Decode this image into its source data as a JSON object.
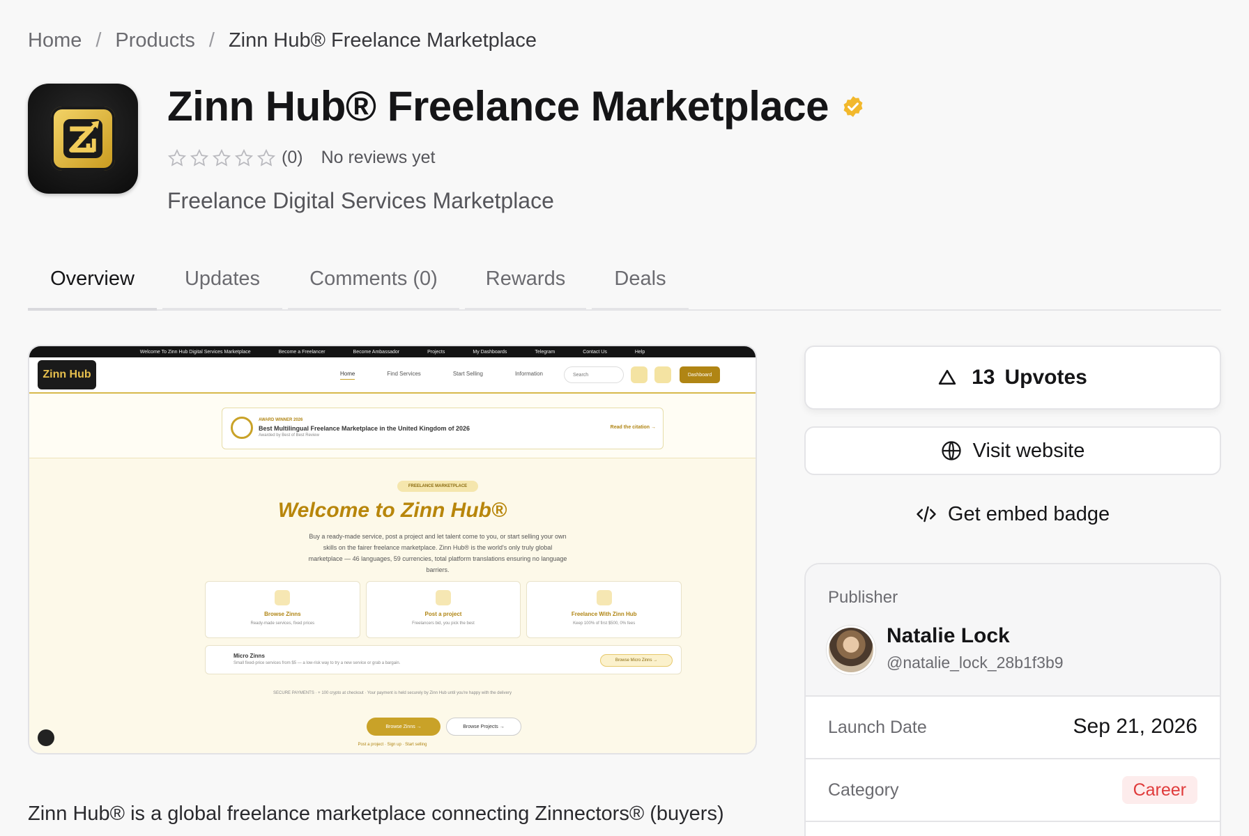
{
  "breadcrumb": {
    "home": "Home",
    "products": "Products",
    "current": "Zinn Hub® Freelance Marketplace",
    "separator": "/"
  },
  "product": {
    "title": "Zinn Hub® Freelance Marketplace",
    "rating_count": "(0)",
    "rating_text": "No reviews yet",
    "rating_value": 0,
    "rating_max": 5,
    "tagline": "Freelance Digital Services Marketplace",
    "description": "Zinn Hub® is a global freelance marketplace connecting Zinnectors® (buyers)"
  },
  "tabs": [
    {
      "label": "Overview",
      "active": true
    },
    {
      "label": "Updates",
      "active": false
    },
    {
      "label": "Comments (0)",
      "active": false
    },
    {
      "label": "Rewards",
      "active": false
    },
    {
      "label": "Deals",
      "active": false
    }
  ],
  "preview": {
    "topbar": [
      "Welcome To Zinn Hub Digital Services Marketplace",
      "Become a Freelancer",
      "Become Ambassador",
      "Projects",
      "My Dashboards",
      "Telegram",
      "Contact Us",
      "Help"
    ],
    "logo": "Zinn Hub",
    "menu": [
      "Home",
      "Find Services",
      "Start Selling",
      "Information"
    ],
    "search": "Search",
    "dashboard": "Dashboard",
    "award_label": "AWARD WINNER 2026",
    "award_title": "Best Multilingual Freelance Marketplace in the United Kingdom of 2026",
    "award_by": "Awarded by Best of Best Review",
    "award_link": "Read the citation →",
    "chip": "FREELANCE MARKETPLACE",
    "heading": "Welcome to Zinn Hub®",
    "paragraph": "Buy a ready-made service, post a project and let talent come to you, or start selling your own skills on the fairer freelance marketplace. Zinn Hub® is the world's only truly global marketplace — 46 languages, 59 currencies, total platform translations ensuring no language barriers.",
    "cards": [
      {
        "title": "Browse Zinns",
        "sub": "Ready-made services, fixed prices"
      },
      {
        "title": "Post a project",
        "sub": "Freelancers bid, you pick the best"
      },
      {
        "title": "Freelance With Zinn Hub",
        "sub": "Keep 100% of first $500, 0% fees"
      }
    ],
    "micro_title": "Micro Zinns",
    "micro_sub": "Small fixed-price services from $5 — a low-risk way to try a new service or grab a bargain.",
    "micro_btn": "Browse Micro Zinns →",
    "payments": "SECURE PAYMENTS · + 100 crypto at checkout · Your payment is held securely by Zinn Hub until you're happy with the delivery",
    "btn_primary": "Browse Zinns →",
    "btn_secondary": "Browse Projects →",
    "links": "Post a project · Sign up · Start selling"
  },
  "actions": {
    "upvote_count": "13",
    "upvote_label": "Upvotes",
    "visit_label": "Visit website",
    "embed_label": "Get embed badge"
  },
  "publisher": {
    "label": "Publisher",
    "name": "Natalie Lock",
    "handle": "@natalie_lock_28b1f3b9"
  },
  "meta": {
    "launch_label": "Launch Date",
    "launch_value": "Sep 21, 2026",
    "category_label": "Category",
    "category_value": "Career"
  },
  "colors": {
    "verified": "#f2b82c",
    "gold": "#c9a228",
    "category_badge_bg": "#fdecec",
    "category_badge_text": "#e03b3b"
  }
}
